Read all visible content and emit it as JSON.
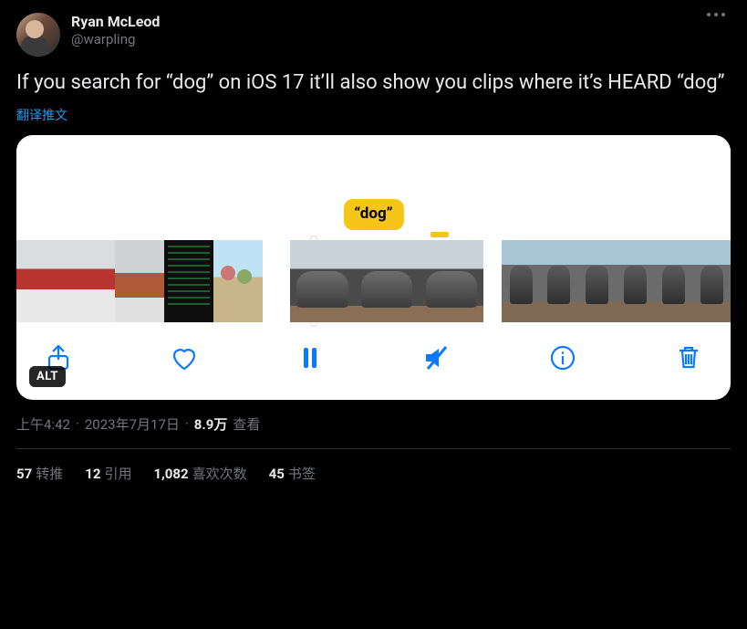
{
  "author": {
    "name": "Ryan McLeod",
    "handle": "@warpling"
  },
  "text": "If you search for “dog” on iOS 17 it’ll also show you clips where it’s HEARD “dog”",
  "translate_label": "翻译推文",
  "media": {
    "tooltip": "“dog”",
    "alt_badge": "ALT",
    "icons": {
      "share": "share-icon",
      "heart": "heart-icon",
      "pause": "pause-icon",
      "mute": "mute-icon",
      "info": "info-icon",
      "trash": "trash-icon"
    }
  },
  "meta": {
    "time": "上午4:42",
    "date": "2023年7月17日",
    "views_num": "8.9万",
    "views_label": "查看"
  },
  "stats": {
    "retweets": {
      "num": "57",
      "label": "转推"
    },
    "quotes": {
      "num": "12",
      "label": "引用"
    },
    "likes": {
      "num": "1,082",
      "label": "喜欢次数"
    },
    "bookmarks": {
      "num": "45",
      "label": "书签"
    }
  }
}
